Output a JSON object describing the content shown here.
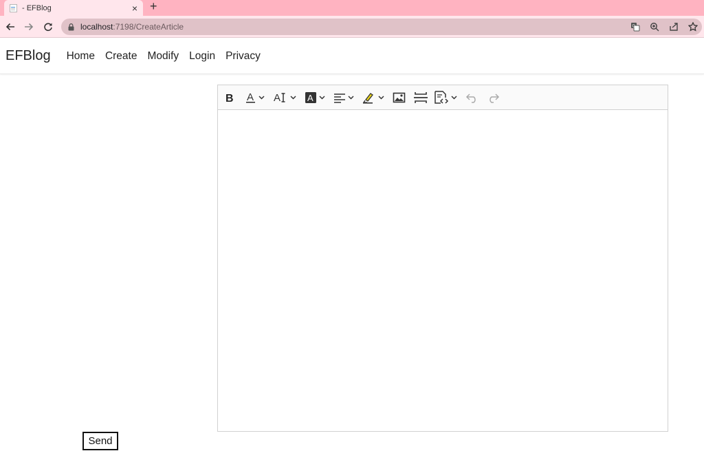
{
  "browser": {
    "tab": {
      "title": "- EFBlog"
    },
    "new_tab_label": "+",
    "close_label": "×",
    "url_host": "localhost",
    "url_path": ":7198/CreateArticle"
  },
  "navbar": {
    "brand": "EFBlog",
    "links": [
      "Home",
      "Create",
      "Modify",
      "Login",
      "Privacy"
    ]
  },
  "editor": {
    "toolbar": [
      "bold-icon",
      "font-color-icon",
      "font-size-icon",
      "background-color-icon",
      "align-icon",
      "highlight-icon",
      "image-icon",
      "horizontal-rule-icon",
      "source-icon",
      "undo-icon",
      "redo-icon"
    ],
    "content": ""
  },
  "form": {
    "send_label": "Send"
  },
  "colors": {
    "tabstrip": "#ffb3c1",
    "toolbar": "#ffe6ec",
    "omnibox": "#e0c2c8",
    "highlight": "#e8d21a"
  }
}
